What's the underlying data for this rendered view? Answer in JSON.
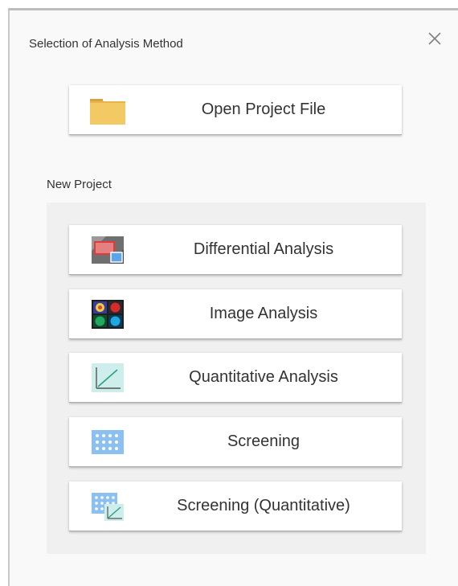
{
  "dialog": {
    "title": "Selection of Analysis Method",
    "close_icon": "close-icon"
  },
  "open_project": {
    "label": "Open Project File",
    "icon": "folder-icon"
  },
  "new_project": {
    "section_label": "New Project",
    "items": [
      {
        "label": "Differential Analysis",
        "icon": "differential-analysis-icon"
      },
      {
        "label": "Image Analysis",
        "icon": "image-analysis-icon"
      },
      {
        "label": "Quantitative Analysis",
        "icon": "quantitative-analysis-icon"
      },
      {
        "label": "Screening",
        "icon": "screening-icon"
      },
      {
        "label": "Screening (Quantitative)",
        "icon": "screening-quantitative-icon"
      }
    ]
  },
  "colors": {
    "folder": "#f0c25a",
    "panel_bg": "#f0f0f0",
    "button_bg": "#ffffff",
    "text": "#333333"
  }
}
